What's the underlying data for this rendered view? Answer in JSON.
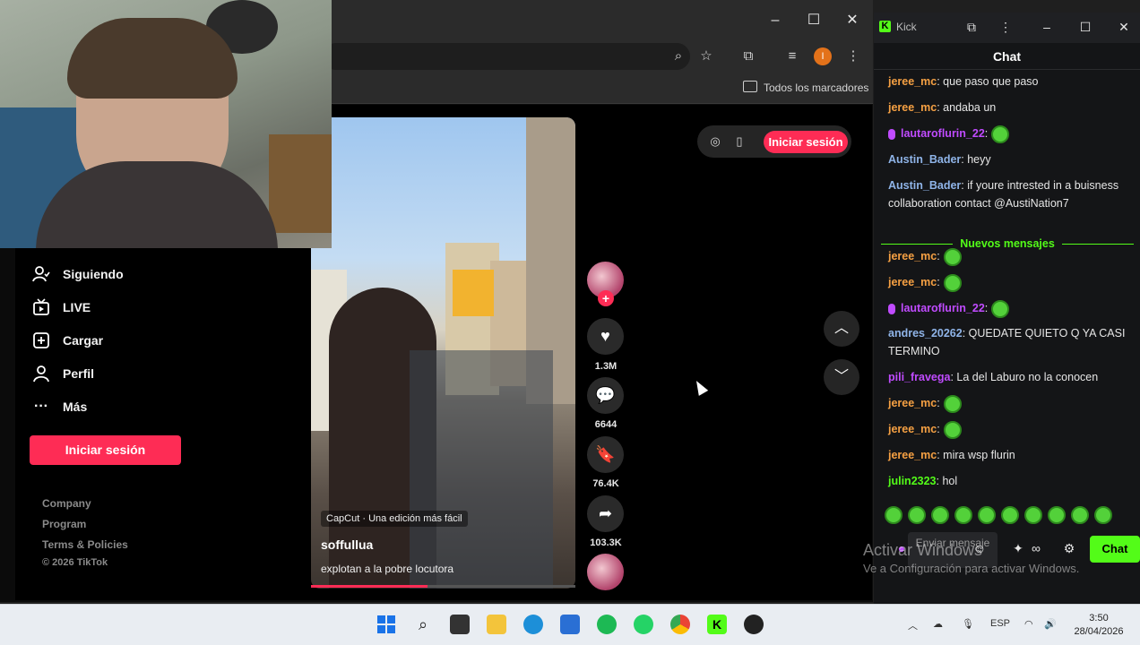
{
  "browser": {
    "bookmarks_label": "Todos los marcadores",
    "profile_initial": "I"
  },
  "tiktok": {
    "sidebar": [
      {
        "label": "Siguiendo",
        "icon": "following-icon"
      },
      {
        "label": "LIVE",
        "icon": "live-tv-icon"
      },
      {
        "label": "Cargar",
        "icon": "upload-icon"
      },
      {
        "label": "Perfil",
        "icon": "profile-icon"
      },
      {
        "label": "Más",
        "icon": "more-icon"
      }
    ],
    "login_label": "Iniciar sesión",
    "footer": [
      "Company",
      "Program",
      "Terms & Policies",
      "© 2026 TikTok"
    ],
    "top_login_label": "Iniciar sesión",
    "video": {
      "capcut": "CapCut · Una edición más fácil",
      "author": "soffullua",
      "caption": "explotan a la pobre locutora",
      "progress": 0.44
    },
    "actions": {
      "likes": "1.3M",
      "comments": "6644",
      "saves": "76.4K",
      "shares": "103.3K"
    }
  },
  "kick": {
    "app_name": "Kick",
    "header": "Chat",
    "messages": [
      {
        "user": "jeree_mc",
        "text": ": que paso que paso",
        "color": "#f5a043"
      },
      {
        "user": "jeree_mc",
        "text": ": andaba un",
        "color": "#f5a043"
      },
      {
        "user": "lautaroflurin_22",
        "text": ":",
        "color": "#c04bff",
        "mic": true,
        "emote": true
      },
      {
        "user": "Austin_Bader",
        "text": ": heyy",
        "color": "#8fb4e8"
      },
      {
        "user": "Austin_Bader",
        "text": ": if youre intrested in a buisness collaboration contact @AustiNation7",
        "color": "#8fb4e8"
      }
    ],
    "new_messages_label": "Nuevos mensajes",
    "messages_after": [
      {
        "user": "jeree_mc",
        "text": ":",
        "color": "#f5a043",
        "emote": true
      },
      {
        "user": "jeree_mc",
        "text": ":",
        "color": "#f5a043",
        "emote": true
      },
      {
        "user": "lautaroflurin_22",
        "text": ":",
        "color": "#c04bff",
        "mic": true,
        "emote": true
      },
      {
        "user": "andres_20262",
        "text": ": QUEDATE QUIETO Q YA CASI TERMINO",
        "color": "#8fb4e8"
      },
      {
        "user": "pili_fravega",
        "text": ": La del Laburo no la conocen",
        "color": "#c04bff"
      },
      {
        "user": "jeree_mc",
        "text": ":",
        "color": "#f5a043",
        "emote": true
      },
      {
        "user": "jeree_mc",
        "text": ":",
        "color": "#f5a043",
        "emote": true
      },
      {
        "user": "jeree_mc",
        "text": ": mira wsp flurin",
        "color": "#f5a043"
      },
      {
        "user": "julin2323",
        "text": ": hol",
        "color": "#53fc18"
      }
    ],
    "input_placeholder": "Enviar mensaje",
    "send_label": "Chat"
  },
  "windows": {
    "activate_line1": "Activar Windows",
    "activate_line2": "Ve a Configuración para activar Windows.",
    "lang": "ESP",
    "time": "3:50",
    "date": "28/04/2026"
  }
}
